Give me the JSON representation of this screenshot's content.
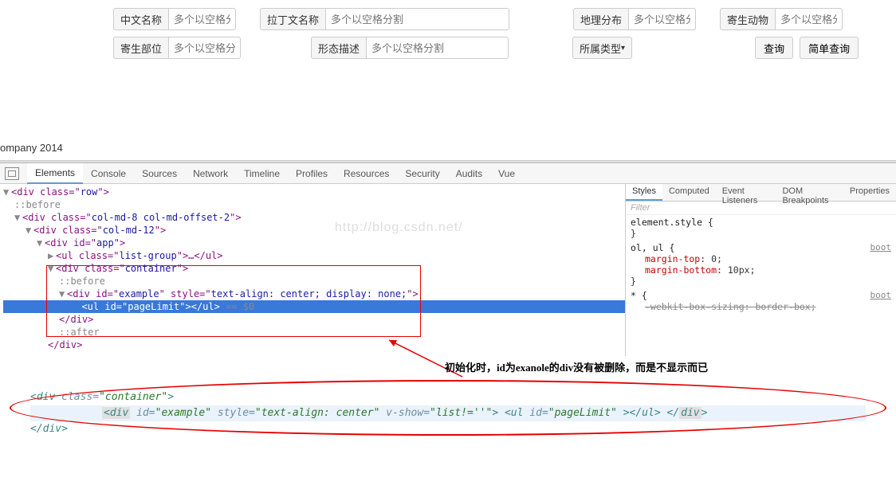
{
  "form": {
    "row1": {
      "f1": {
        "label": "中文名称",
        "ph": "多个以空格分"
      },
      "f2": {
        "label": "拉丁文名称",
        "ph": "多个以空格分割"
      },
      "f3": {
        "label": "地理分布",
        "ph": "多个以空格分"
      },
      "f4": {
        "label": "寄生动物",
        "ph": "多个以空格分"
      }
    },
    "row2": {
      "f1": {
        "label": "寄生部位",
        "ph": "多个以空格分割"
      },
      "f2": {
        "label": "形态描述",
        "ph": "多个以空格分割"
      },
      "sel": "所属类型",
      "btn1": "查询",
      "btn2": "简单查询"
    }
  },
  "footer": "ompany 2014",
  "devtabs": [
    "Elements",
    "Console",
    "Sources",
    "Network",
    "Timeline",
    "Profiles",
    "Resources",
    "Security",
    "Audits",
    "Vue"
  ],
  "devtabs_active": "Elements",
  "dom": {
    "l1": {
      "pre": "▼",
      "open": "<div class=\"",
      "val": "row",
      "close": "\">"
    },
    "l2": "::before",
    "l3": {
      "pre": "▼",
      "open": "<div class=\"",
      "val": "col-md-8 col-md-offset-2",
      "close": "\">"
    },
    "l4": {
      "pre": "▼",
      "open": "<div class=\"",
      "val": "col-md-12",
      "close": "\">"
    },
    "l5": {
      "pre": "▼",
      "open": "<div id=\"",
      "val": "app",
      "close": "\">"
    },
    "l6": {
      "pre": "▶",
      "open": "<ul class=\"",
      "val": "list-group",
      "mid": "\">…</",
      "end": "ul>"
    },
    "l7": {
      "pre": "▼",
      "open": "<div class=\"",
      "val": "container",
      "close": "\">"
    },
    "l8": "::before",
    "l9": {
      "pre": "▼",
      "open": "<div id=\"",
      "v1": "example",
      "mid": "\" style=\"",
      "v2": "text-align: center; display: none;",
      "close": "\">"
    },
    "l10": {
      "open": "<ul id=\"",
      "val": "pageLimit",
      "close": "\"></ul>",
      "eq": " == $0"
    },
    "l11": "</div>",
    "l12": "::after",
    "l13": "</div>"
  },
  "watermark": "http://blog.csdn.net/",
  "styles": {
    "tabs": [
      "Styles",
      "Computed",
      "Event Listeners",
      "DOM Breakpoints",
      "Properties"
    ],
    "active": "Styles",
    "filter": "Filter",
    "b1": "element.style {",
    "b1c": "}",
    "b2sel": "ol, ul {",
    "b2src": "boot",
    "b2p1n": "margin-top",
    "b2p1v": "0;",
    "b2p2n": "margin-bottom",
    "b2p2v": "10px;",
    "b2c": "}",
    "b3sel": "* {",
    "b3src": "boot",
    "b3pn": "-webkit-box-sizing",
    "b3pv": "border-box;"
  },
  "annot": "初始化时，id为exanole的div没有被删除，而是不显示而已",
  "snippet": {
    "l1a": "<div",
    "l1b": " class=",
    "l1c": "\"container\"",
    "l1d": ">",
    "l2a": "<div",
    "l2b": " id=",
    "l2c": "\"example\"",
    "l2d": "  style=",
    "l2e": "\"text-align: center\"",
    "l2f": " v-show=",
    "l2g": "\"list!=''\"",
    "l2h": "> <ul",
    "l2i": " id=",
    "l2j": "\"pageLimit\"",
    "l2k": " ></ul> </",
    "l2l": "div",
    "l2m": ">",
    "l3": "</div>"
  }
}
